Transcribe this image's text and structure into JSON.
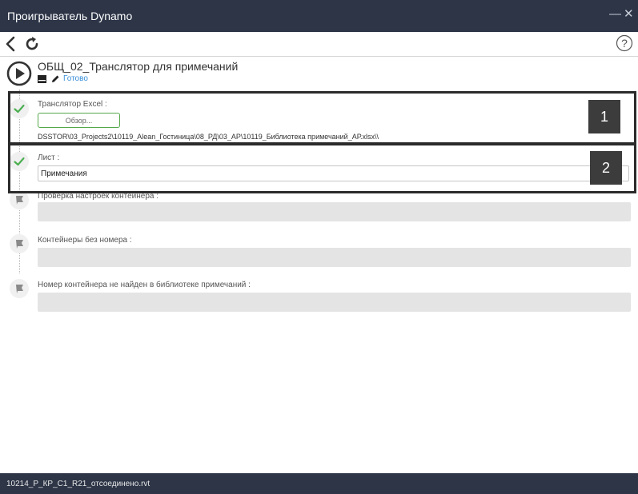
{
  "window": {
    "title": "Проигрыватель Dynamo",
    "minimize_icon": "minimize-icon",
    "close_icon": "close-icon"
  },
  "toolbar": {
    "back_icon": "chevron-left-icon",
    "refresh_icon": "refresh-icon",
    "help_icon": "help-icon",
    "help_glyph": "?"
  },
  "graph": {
    "name": "ОБЩ_02_Транслятор для примечаний",
    "status": "Готово",
    "play_icon": "play-icon",
    "doc_icon": "document-icon",
    "edit_icon": "pencil-icon"
  },
  "steps": [
    {
      "label": "Транслятор Excel :",
      "state": "done",
      "icon": "check-icon",
      "button_label": "Обзор...",
      "path": "DSSTOR\\03_Projects2\\10119_Alean_Гостиница\\08_РД\\03_АР\\10119_Библиотека примечаний_АР.xlsx\\\\"
    },
    {
      "label": "Лист :",
      "state": "done",
      "icon": "check-icon",
      "value": "Примечания"
    },
    {
      "label": "Проверка настроек контейнера :",
      "state": "pending",
      "icon": "flag-icon",
      "value": ""
    },
    {
      "label": "Контейнеры без номера :",
      "state": "pending",
      "icon": "flag-icon",
      "value": ""
    },
    {
      "label": "Номер контейнера не найден в библиотеке примечаний :",
      "state": "pending",
      "icon": "flag-icon",
      "value": ""
    }
  ],
  "callouts": [
    "1",
    "2"
  ],
  "colors": {
    "titlebar": "#2d3547",
    "check_green": "#4caf50",
    "status_blue": "#3a8fd9",
    "callout": "#3c3c3c"
  },
  "statusbar": {
    "document": "10214_Р_КР_С1_R21_отсоединено.rvt"
  }
}
